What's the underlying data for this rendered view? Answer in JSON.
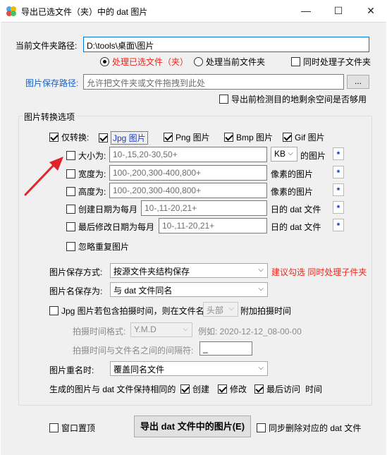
{
  "window": {
    "title": "导出已选文件（夹）中的 dat 图片",
    "minimize": "—",
    "maximize": "☐",
    "close": "✕"
  },
  "folder_path": {
    "label": "当前文件夹路径:",
    "value": "D:\\tools\\桌面\\图片"
  },
  "process_options": {
    "selected": "处理已选文件（夹）",
    "current": "处理当前文件夹",
    "subfolders": "同时处理子文件夹"
  },
  "save_path": {
    "label": "图片保存路径:",
    "placeholder": "允许把文件夹或文件拖拽到此处",
    "browse": "...",
    "check_space": "导出前检测目的地剩余空间是否够用"
  },
  "convert": {
    "group_title": "图片转换选项",
    "convert_label": "仅转换:",
    "jpg": "Jpg 图片",
    "png": "Png 图片",
    "bmp": "Bmp 图片",
    "gif": "Gif 图片",
    "size_label": "大小为:",
    "size_value": "10-,15,20-30,50+",
    "size_unit": "KB",
    "size_suffix": "的图片",
    "width_label": "宽度为:",
    "width_value": "100-,200,300-400,800+",
    "width_suffix": "像素的图片",
    "height_label": "高度为:",
    "height_value": "100-,200,300-400,800+",
    "height_suffix": "像素的图片",
    "created_label": "创建日期为每月",
    "created_value": "10-,11-20,21+",
    "created_suffix": "日的 dat 文件",
    "modified_label": "最后修改日期为每月",
    "modified_value": "10-,11-20,21+",
    "modified_suffix": "日的 dat 文件",
    "ignore_dup": "忽略重复图片",
    "star": "*"
  },
  "save_mode": {
    "label": "图片保存方式:",
    "value": "按源文件夹结构保存",
    "hint": "建议勾选 同时处理子件夹"
  },
  "save_name": {
    "label": "图片名保存为:",
    "value": "与 dat 文件同名"
  },
  "shoot_time": {
    "label": "Jpg 图片若包含拍摄时间，则在文件名",
    "position": "头部",
    "suffix": "附加拍摄时间",
    "format_label": "拍摄时间格式:",
    "format_value": "Y.M.D",
    "example": "例如: 2020-12-12_08-00-00",
    "sep_label": "拍摄时间与文件名之间的间隔符:",
    "sep_value": "_"
  },
  "rename": {
    "label": "图片重名时:",
    "value": "覆盖同名文件"
  },
  "keep_same": {
    "label": "生成的图片与 dat 文件保持相同的",
    "created": "创建",
    "modified": "修改",
    "accessed": "最后访问",
    "time": "时间"
  },
  "bottom": {
    "topmost": "窗口置顶",
    "export": "导出 dat 文件中的图片(E)",
    "delete_sync": "同步删除对应的 dat 文件"
  },
  "colors": {
    "accent": "#0078d7",
    "hint_red": "#e8281e",
    "arrow_red": "#e0242c"
  }
}
